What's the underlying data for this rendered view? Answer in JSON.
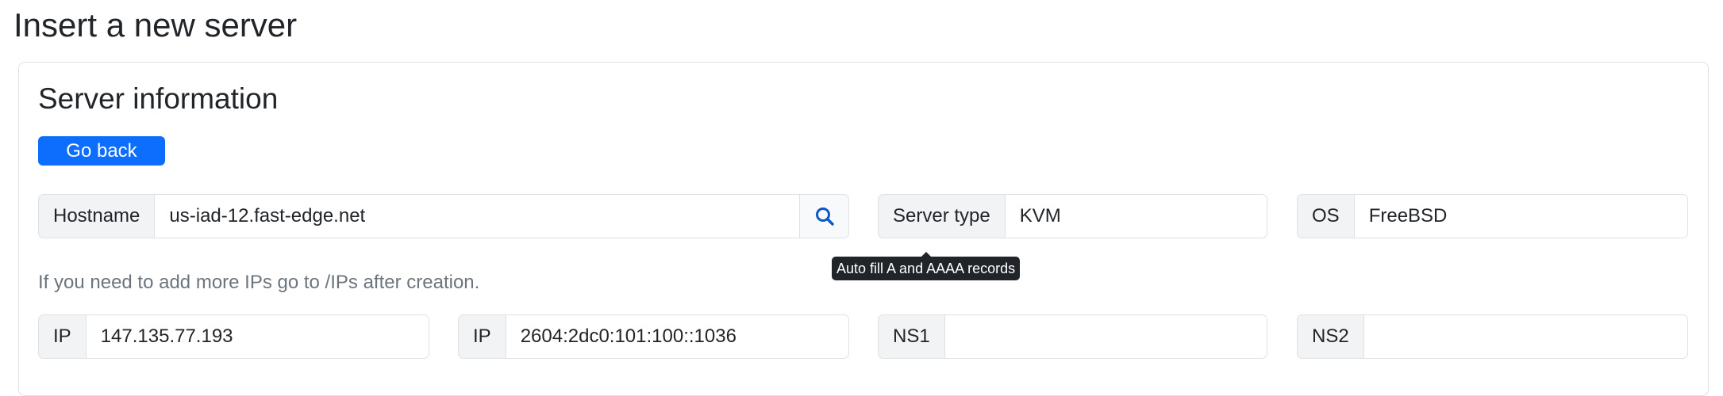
{
  "page": {
    "title": "Insert a new server"
  },
  "card": {
    "title": "Server information",
    "go_back_label": "Go back"
  },
  "fields": {
    "hostname": {
      "label": "Hostname",
      "value": "us-iad-12.fast-edge.net"
    },
    "server_type": {
      "label": "Server type",
      "value": "KVM"
    },
    "os": {
      "label": "OS",
      "value": "FreeBSD"
    },
    "ip1": {
      "label": "IP",
      "value": "147.135.77.193"
    },
    "ip2": {
      "label": "IP",
      "value": "2604:2dc0:101:100::1036"
    },
    "ns1": {
      "label": "NS1",
      "value": ""
    },
    "ns2": {
      "label": "NS2",
      "value": ""
    }
  },
  "help_text": "If you need to add more IPs go to /IPs after creation.",
  "tooltip": "Auto fill A and AAAA records",
  "icons": {
    "lookup": "search-icon"
  },
  "colors": {
    "primary": "#0d6efd",
    "icon": "#0a58ca"
  }
}
